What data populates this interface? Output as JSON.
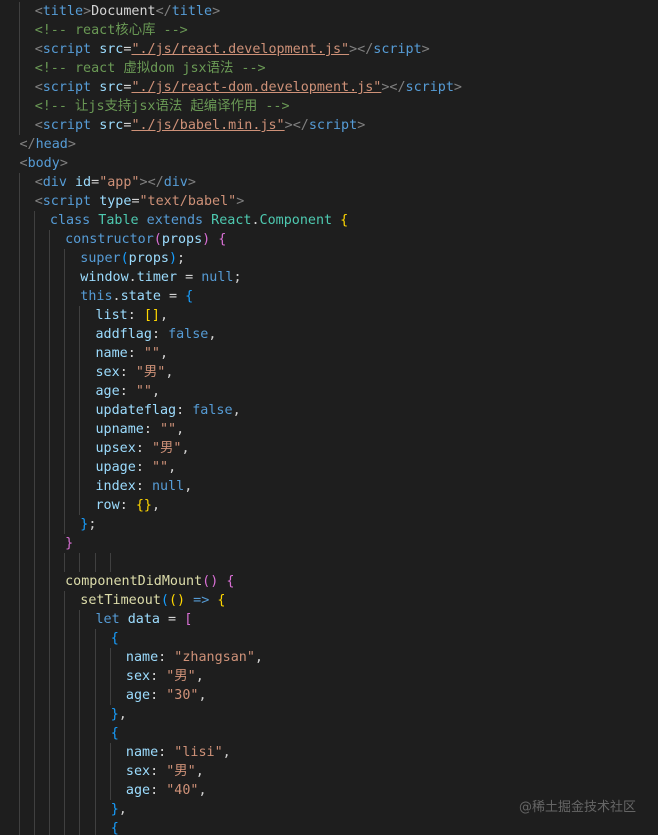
{
  "colors": {
    "background": "#1e1e1e",
    "text": "#d4d4d4",
    "tag": "#569cd6",
    "bracket_tag": "#808080",
    "attr": "#9cdcfe",
    "string": "#ce9178",
    "comment": "#6a9955",
    "keyword": "#569cd6",
    "class_name": "#4ec9b0",
    "function": "#dcdcaa",
    "control": "#c586c0",
    "bracket_gold": "#ffd700",
    "bracket_purple": "#da70d6",
    "bracket_blue": "#179fff",
    "number": "#b5cea8"
  },
  "watermark": "@稀土掘金技术社区",
  "code_lines": [
    {
      "indent": 2,
      "tokens": [
        [
          "<",
          "bracket_tag"
        ],
        [
          "title",
          "tag"
        ],
        [
          ">",
          "bracket_tag"
        ],
        [
          "Document",
          "text"
        ],
        [
          "</",
          "bracket_tag"
        ],
        [
          "title",
          "tag"
        ],
        [
          ">",
          "bracket_tag"
        ]
      ]
    },
    {
      "indent": 2,
      "tokens": [
        [
          "<!-- react核心库 -->",
          "comment"
        ]
      ]
    },
    {
      "indent": 2,
      "tokens": [
        [
          "<",
          "bracket_tag"
        ],
        [
          "script",
          "tag"
        ],
        [
          " ",
          "text"
        ],
        [
          "src",
          "attr"
        ],
        [
          "=",
          "text"
        ],
        [
          "\"./js/react.development.js\"",
          "string",
          "ul"
        ],
        [
          ">",
          "bracket_tag"
        ],
        [
          "</",
          "bracket_tag"
        ],
        [
          "script",
          "tag"
        ],
        [
          ">",
          "bracket_tag"
        ]
      ]
    },
    {
      "indent": 2,
      "tokens": [
        [
          "<!-- react 虚拟dom jsx语法 -->",
          "comment"
        ]
      ]
    },
    {
      "indent": 2,
      "tokens": [
        [
          "<",
          "bracket_tag"
        ],
        [
          "script",
          "tag"
        ],
        [
          " ",
          "text"
        ],
        [
          "src",
          "attr"
        ],
        [
          "=",
          "text"
        ],
        [
          "\"./js/react-dom.development.js\"",
          "string",
          "ul"
        ],
        [
          ">",
          "bracket_tag"
        ],
        [
          "</",
          "bracket_tag"
        ],
        [
          "script",
          "tag"
        ],
        [
          ">",
          "bracket_tag"
        ]
      ]
    },
    {
      "indent": 2,
      "tokens": [
        [
          "<!-- 让js支持jsx语法 起编译作用 -->",
          "comment"
        ]
      ]
    },
    {
      "indent": 2,
      "tokens": [
        [
          "<",
          "bracket_tag"
        ],
        [
          "script",
          "tag"
        ],
        [
          " ",
          "text"
        ],
        [
          "src",
          "attr"
        ],
        [
          "=",
          "text"
        ],
        [
          "\"./js/babel.min.js\"",
          "string",
          "ul"
        ],
        [
          ">",
          "bracket_tag"
        ],
        [
          "</",
          "bracket_tag"
        ],
        [
          "script",
          "tag"
        ],
        [
          ">",
          "bracket_tag"
        ]
      ]
    },
    {
      "indent": 0,
      "tokens": [
        [
          "</",
          "bracket_tag"
        ],
        [
          "head",
          "tag"
        ],
        [
          ">",
          "bracket_tag"
        ]
      ]
    },
    {
      "indent": 0,
      "tokens": [
        [
          "<",
          "bracket_tag"
        ],
        [
          "body",
          "tag"
        ],
        [
          ">",
          "bracket_tag"
        ]
      ]
    },
    {
      "indent": 2,
      "tokens": [
        [
          "<",
          "bracket_tag"
        ],
        [
          "div",
          "tag"
        ],
        [
          " ",
          "text"
        ],
        [
          "id",
          "attr"
        ],
        [
          "=",
          "text"
        ],
        [
          "\"app\"",
          "string"
        ],
        [
          ">",
          "bracket_tag"
        ],
        [
          "</",
          "bracket_tag"
        ],
        [
          "div",
          "tag"
        ],
        [
          ">",
          "bracket_tag"
        ]
      ]
    },
    {
      "indent": 2,
      "tokens": [
        [
          "<",
          "bracket_tag"
        ],
        [
          "script",
          "tag"
        ],
        [
          " ",
          "text"
        ],
        [
          "type",
          "attr"
        ],
        [
          "=",
          "text"
        ],
        [
          "\"text/babel\"",
          "string"
        ],
        [
          ">",
          "bracket_tag"
        ]
      ]
    },
    {
      "indent": 4,
      "tokens": [
        [
          "class",
          "keyword"
        ],
        [
          " ",
          "text"
        ],
        [
          "Table",
          "class_name"
        ],
        [
          " ",
          "text"
        ],
        [
          "extends",
          "keyword"
        ],
        [
          " ",
          "text"
        ],
        [
          "React",
          "class_name"
        ],
        [
          ".",
          "text"
        ],
        [
          "Component",
          "class_name"
        ],
        [
          " ",
          "text"
        ],
        [
          "{",
          "bracket_gold"
        ]
      ]
    },
    {
      "indent": 6,
      "tokens": [
        [
          "constructor",
          "keyword"
        ],
        [
          "(",
          "bracket_purple"
        ],
        [
          "props",
          "attr"
        ],
        [
          ")",
          "bracket_purple"
        ],
        [
          " ",
          "text"
        ],
        [
          "{",
          "bracket_purple"
        ]
      ]
    },
    {
      "indent": 8,
      "tokens": [
        [
          "super",
          "keyword"
        ],
        [
          "(",
          "bracket_blue"
        ],
        [
          "props",
          "attr"
        ],
        [
          ")",
          "bracket_blue"
        ],
        [
          ";",
          "text"
        ]
      ]
    },
    {
      "indent": 8,
      "tokens": [
        [
          "window",
          "attr"
        ],
        [
          ".",
          "text"
        ],
        [
          "timer",
          "attr"
        ],
        [
          " = ",
          "text"
        ],
        [
          "null",
          "keyword"
        ],
        [
          ";",
          "text"
        ]
      ]
    },
    {
      "indent": 8,
      "tokens": [
        [
          "this",
          "keyword"
        ],
        [
          ".",
          "text"
        ],
        [
          "state",
          "attr"
        ],
        [
          " = ",
          "text"
        ],
        [
          "{",
          "bracket_blue"
        ]
      ]
    },
    {
      "indent": 10,
      "tokens": [
        [
          "list",
          "attr"
        ],
        [
          ": ",
          "text"
        ],
        [
          "[]",
          "bracket_gold"
        ],
        [
          ",",
          "text"
        ]
      ]
    },
    {
      "indent": 10,
      "tokens": [
        [
          "addflag",
          "attr"
        ],
        [
          ": ",
          "text"
        ],
        [
          "false",
          "keyword"
        ],
        [
          ",",
          "text"
        ]
      ]
    },
    {
      "indent": 10,
      "tokens": [
        [
          "name",
          "attr"
        ],
        [
          ": ",
          "text"
        ],
        [
          "\"\"",
          "string"
        ],
        [
          ",",
          "text"
        ]
      ]
    },
    {
      "indent": 10,
      "tokens": [
        [
          "sex",
          "attr"
        ],
        [
          ": ",
          "text"
        ],
        [
          "\"男\"",
          "string"
        ],
        [
          ",",
          "text"
        ]
      ]
    },
    {
      "indent": 10,
      "tokens": [
        [
          "age",
          "attr"
        ],
        [
          ": ",
          "text"
        ],
        [
          "\"\"",
          "string"
        ],
        [
          ",",
          "text"
        ]
      ]
    },
    {
      "indent": 10,
      "tokens": [
        [
          "updateflag",
          "attr"
        ],
        [
          ": ",
          "text"
        ],
        [
          "false",
          "keyword"
        ],
        [
          ",",
          "text"
        ]
      ]
    },
    {
      "indent": 10,
      "tokens": [
        [
          "upname",
          "attr"
        ],
        [
          ": ",
          "text"
        ],
        [
          "\"\"",
          "string"
        ],
        [
          ",",
          "text"
        ]
      ]
    },
    {
      "indent": 10,
      "tokens": [
        [
          "upsex",
          "attr"
        ],
        [
          ": ",
          "text"
        ],
        [
          "\"男\"",
          "string"
        ],
        [
          ",",
          "text"
        ]
      ]
    },
    {
      "indent": 10,
      "tokens": [
        [
          "upage",
          "attr"
        ],
        [
          ": ",
          "text"
        ],
        [
          "\"\"",
          "string"
        ],
        [
          ",",
          "text"
        ]
      ]
    },
    {
      "indent": 10,
      "tokens": [
        [
          "index",
          "attr"
        ],
        [
          ": ",
          "text"
        ],
        [
          "null",
          "keyword"
        ],
        [
          ",",
          "text"
        ]
      ]
    },
    {
      "indent": 10,
      "tokens": [
        [
          "row",
          "attr"
        ],
        [
          ": ",
          "text"
        ],
        [
          "{}",
          "bracket_gold"
        ],
        [
          ",",
          "text"
        ]
      ]
    },
    {
      "indent": 8,
      "tokens": [
        [
          "}",
          "bracket_blue"
        ],
        [
          ";",
          "text"
        ]
      ]
    },
    {
      "indent": 6,
      "tokens": [
        [
          "}",
          "bracket_purple"
        ]
      ]
    },
    {
      "indent": 0,
      "tokens": []
    },
    {
      "indent": 6,
      "tokens": [
        [
          "componentDidMount",
          "function"
        ],
        [
          "()",
          "bracket_purple"
        ],
        [
          " ",
          "text"
        ],
        [
          "{",
          "bracket_purple"
        ]
      ]
    },
    {
      "indent": 8,
      "tokens": [
        [
          "setTimeout",
          "function"
        ],
        [
          "(",
          "bracket_blue"
        ],
        [
          "()",
          "bracket_gold"
        ],
        [
          " ",
          "text"
        ],
        [
          "=>",
          "keyword"
        ],
        [
          " ",
          "text"
        ],
        [
          "{",
          "bracket_gold"
        ]
      ]
    },
    {
      "indent": 10,
      "tokens": [
        [
          "let",
          "keyword"
        ],
        [
          " ",
          "text"
        ],
        [
          "data",
          "attr"
        ],
        [
          " = ",
          "text"
        ],
        [
          "[",
          "bracket_purple"
        ]
      ]
    },
    {
      "indent": 12,
      "tokens": [
        [
          "{",
          "bracket_blue"
        ]
      ]
    },
    {
      "indent": 14,
      "tokens": [
        [
          "name",
          "attr"
        ],
        [
          ": ",
          "text"
        ],
        [
          "\"zhangsan\"",
          "string"
        ],
        [
          ",",
          "text"
        ]
      ]
    },
    {
      "indent": 14,
      "tokens": [
        [
          "sex",
          "attr"
        ],
        [
          ": ",
          "text"
        ],
        [
          "\"男\"",
          "string"
        ],
        [
          ",",
          "text"
        ]
      ]
    },
    {
      "indent": 14,
      "tokens": [
        [
          "age",
          "attr"
        ],
        [
          ": ",
          "text"
        ],
        [
          "\"30\"",
          "string"
        ],
        [
          ",",
          "text"
        ]
      ]
    },
    {
      "indent": 12,
      "tokens": [
        [
          "}",
          "bracket_blue"
        ],
        [
          ",",
          "text"
        ]
      ]
    },
    {
      "indent": 12,
      "tokens": [
        [
          "{",
          "bracket_blue"
        ]
      ]
    },
    {
      "indent": 14,
      "tokens": [
        [
          "name",
          "attr"
        ],
        [
          ": ",
          "text"
        ],
        [
          "\"lisi\"",
          "string"
        ],
        [
          ",",
          "text"
        ]
      ]
    },
    {
      "indent": 14,
      "tokens": [
        [
          "sex",
          "attr"
        ],
        [
          ": ",
          "text"
        ],
        [
          "\"男\"",
          "string"
        ],
        [
          ",",
          "text"
        ]
      ]
    },
    {
      "indent": 14,
      "tokens": [
        [
          "age",
          "attr"
        ],
        [
          ": ",
          "text"
        ],
        [
          "\"40\"",
          "string"
        ],
        [
          ",",
          "text"
        ]
      ]
    },
    {
      "indent": 12,
      "tokens": [
        [
          "}",
          "bracket_blue"
        ],
        [
          ",",
          "text"
        ]
      ]
    },
    {
      "indent": 12,
      "tokens": [
        [
          "{",
          "bracket_blue"
        ]
      ]
    }
  ]
}
